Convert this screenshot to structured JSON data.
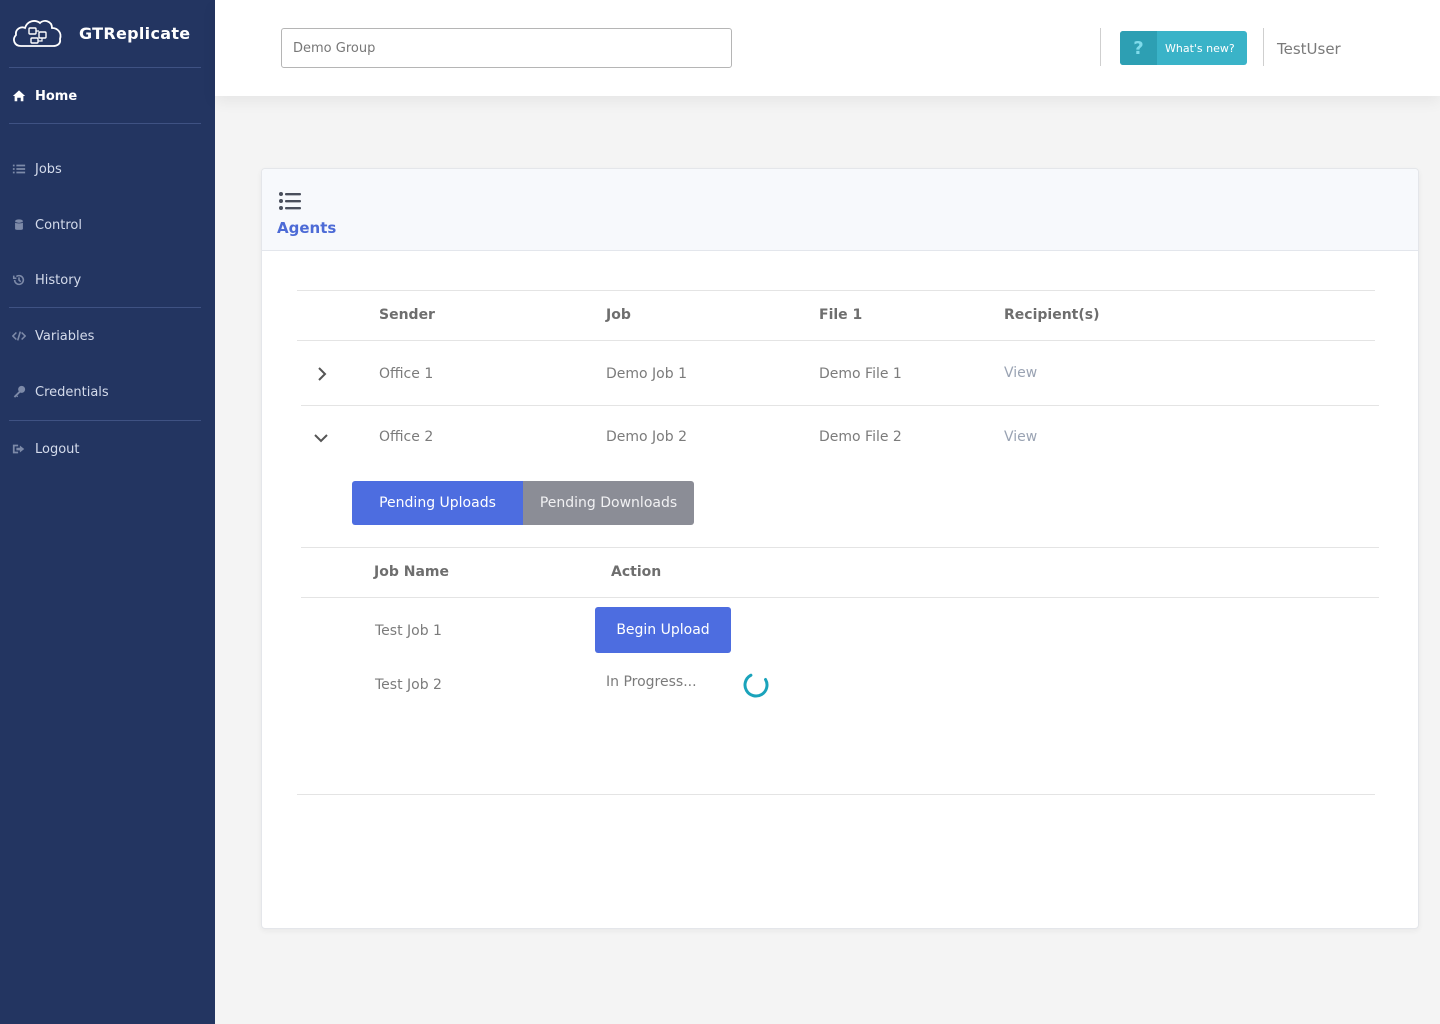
{
  "sidebar": {
    "brand": "GTReplicate",
    "items": [
      {
        "label": "Home",
        "icon": "home-icon"
      },
      {
        "label": "Jobs",
        "icon": "list-icon"
      },
      {
        "label": "Control",
        "icon": "database-icon"
      },
      {
        "label": "History",
        "icon": "history-icon"
      },
      {
        "label": "Variables",
        "icon": "code-icon"
      },
      {
        "label": "Credentials",
        "icon": "key-icon"
      },
      {
        "label": "Logout",
        "icon": "logout-icon"
      }
    ]
  },
  "header": {
    "group_value": "Demo Group",
    "whats_new_label": "What's new?",
    "whats_new_icon": "?",
    "username": "TestUser"
  },
  "card": {
    "title": "Agents",
    "columns": [
      "Sender",
      "Job",
      "File 1",
      "Recipient(s)"
    ],
    "rows": [
      {
        "sender": "Office 1",
        "job": "Demo Job 1",
        "file": "Demo File 1",
        "recipients": "View",
        "expanded": false
      },
      {
        "sender": "Office 2",
        "job": "Demo Job 2",
        "file": "Demo File 2",
        "recipients": "View",
        "expanded": true
      }
    ],
    "tabs": [
      "Pending Uploads",
      "Pending Downloads"
    ],
    "sub_columns": [
      "Job Name",
      "Action"
    ],
    "sub_rows": [
      {
        "job_name": "Test Job 1",
        "action": "Begin Upload"
      },
      {
        "job_name": "Test Job 2",
        "action": "In Progress..."
      }
    ]
  },
  "colors": {
    "sidebar_bg": "#233561",
    "accent": "#4d6de0",
    "whats_new": "#3ab3c8",
    "spinner": "#1aa3bb"
  }
}
